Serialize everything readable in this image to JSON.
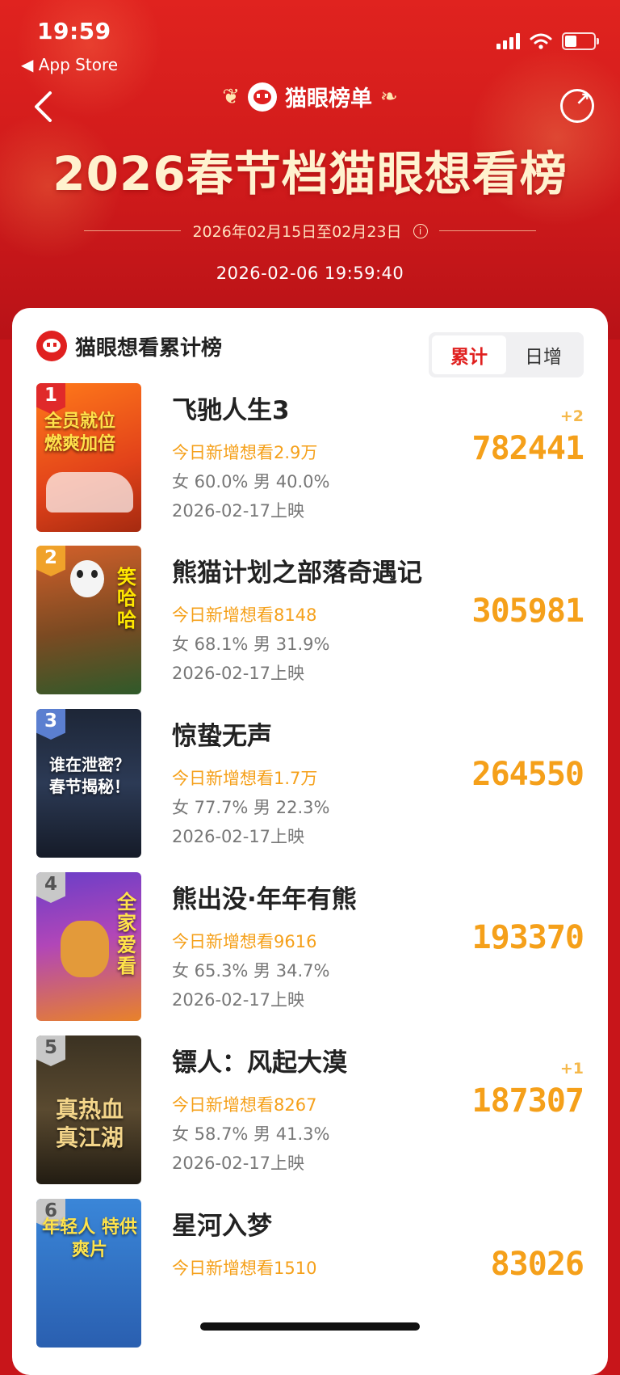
{
  "status_bar": {
    "time": "19:59",
    "back_app": "◀ App Store"
  },
  "header": {
    "brand": "猫眼榜单",
    "title": "2026春节档猫眼想看榜",
    "date_range": "2026年02月15日至02月23日",
    "timestamp": "2026-02-06  19:59:40"
  },
  "board": {
    "title": "猫眼想看累计榜",
    "tabs": [
      "累计",
      "日增"
    ],
    "active_tab": "累计"
  },
  "colors": {
    "accent_red": "#e0201f",
    "orange": "#f5a01a"
  },
  "movies": [
    {
      "rank": "1",
      "name": "飞驰人生3",
      "daily": "今日新增想看2.9万",
      "gender": "女 60.0% 男 40.0%",
      "release": "2026-02-17上映",
      "count": "782441",
      "change": "+2",
      "poster_text": "全员就位 燃爽加倍"
    },
    {
      "rank": "2",
      "name": "熊猫计划之部落奇遇记",
      "daily": "今日新增想看8148",
      "gender": "女 68.1% 男 31.9%",
      "release": "2026-02-17上映",
      "count": "305981",
      "change": "",
      "poster_text": "笑哈哈"
    },
    {
      "rank": "3",
      "name": "惊蛰无声",
      "daily": "今日新增想看1.7万",
      "gender": "女 77.7% 男 22.3%",
      "release": "2026-02-17上映",
      "count": "264550",
      "change": "",
      "poster_text": "谁在泄密？ 春节揭秘！"
    },
    {
      "rank": "4",
      "name": "熊出没·年年有熊",
      "daily": "今日新增想看9616",
      "gender": "女 65.3% 男 34.7%",
      "release": "2026-02-17上映",
      "count": "193370",
      "change": "",
      "poster_text": "全家爱看"
    },
    {
      "rank": "5",
      "name": "镖人：风起大漠",
      "daily": "今日新增想看8267",
      "gender": "女 58.7% 男 41.3%",
      "release": "2026-02-17上映",
      "count": "187307",
      "change": "+1",
      "poster_text": "真热血 真江湖"
    },
    {
      "rank": "6",
      "name": "星河入梦",
      "daily": "今日新增想看1510",
      "gender": "",
      "release": "",
      "count": "83026",
      "change": "",
      "poster_text": "年轻人 特供爽片"
    }
  ]
}
